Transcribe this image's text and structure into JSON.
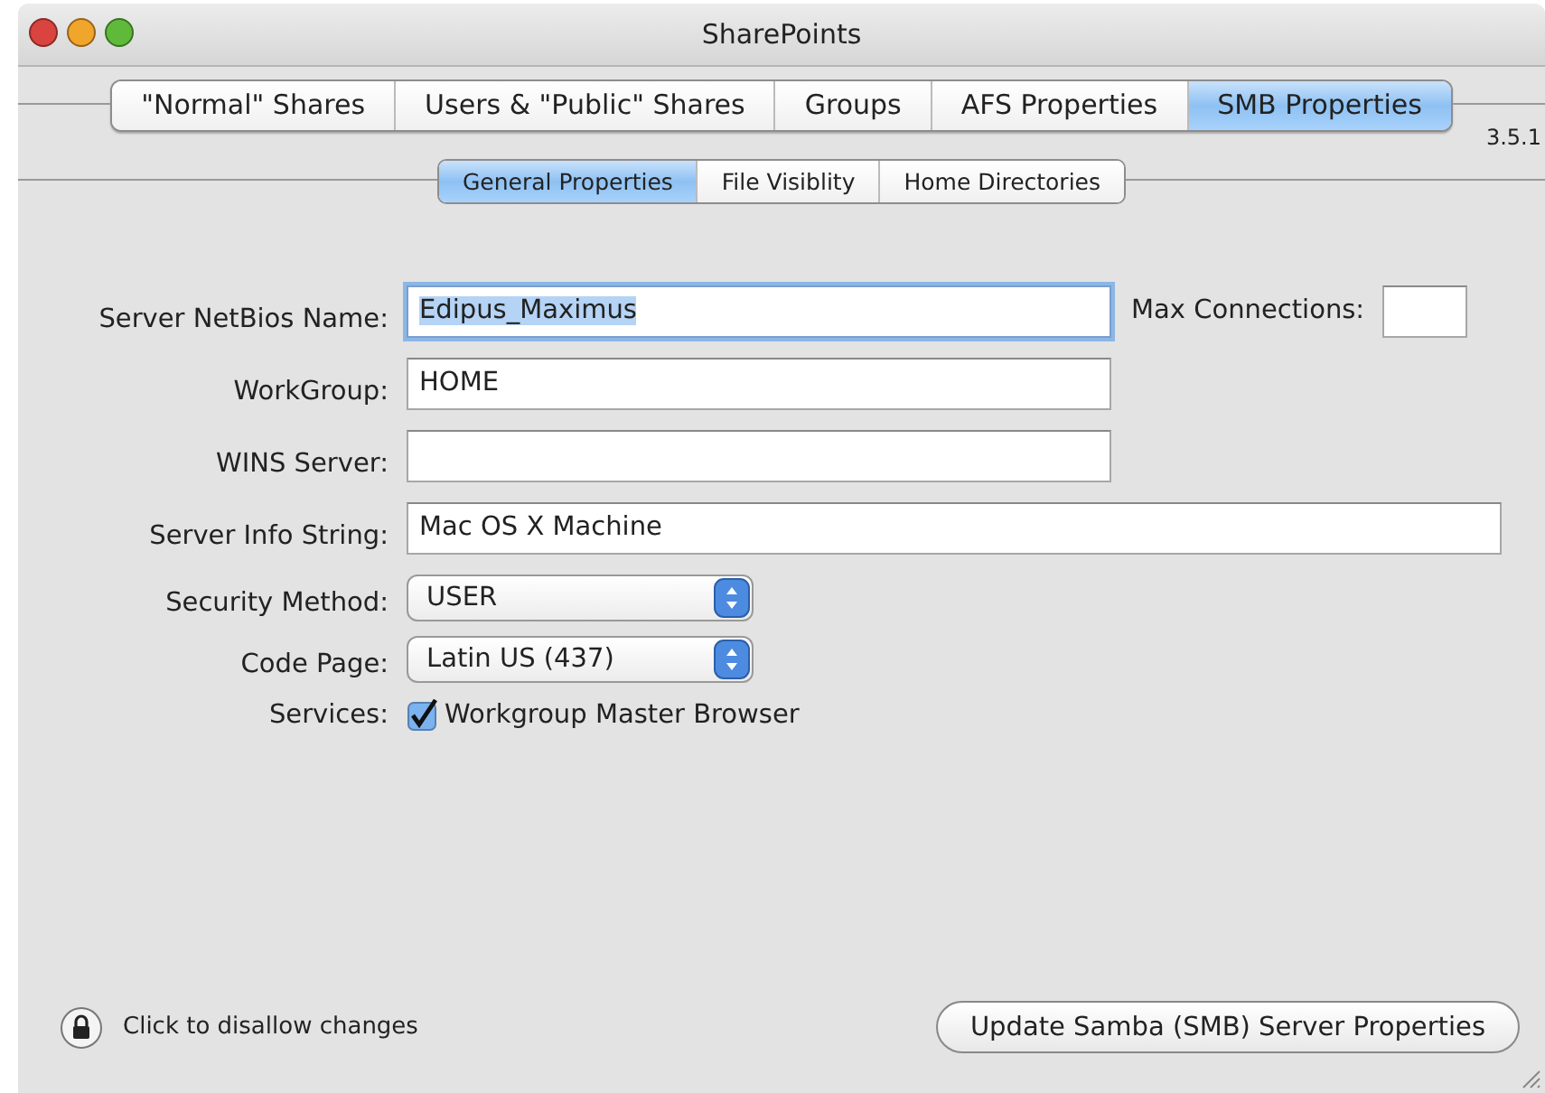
{
  "window": {
    "title": "SharePoints"
  },
  "tabs": [
    {
      "label": "\"Normal\" Shares",
      "selected": false
    },
    {
      "label": "Users & \"Public\" Shares",
      "selected": false
    },
    {
      "label": "Groups",
      "selected": false
    },
    {
      "label": "AFS Properties",
      "selected": false
    },
    {
      "label": "SMB Properties",
      "selected": true
    }
  ],
  "version": "3.5.1",
  "subtabs": [
    {
      "label": "General Properties",
      "selected": true
    },
    {
      "label": "File Visiblity",
      "selected": false
    },
    {
      "label": "Home Directories",
      "selected": false
    }
  ],
  "form": {
    "rows": [
      {
        "kind": "text",
        "label": "Server NetBios Name:",
        "value": "Edipus_Maximus",
        "focused": true,
        "extra": {
          "label": "Max Connections:"
        }
      },
      {
        "kind": "text",
        "label": "WorkGroup:",
        "value": "HOME",
        "focused": false
      },
      {
        "kind": "text",
        "label": "WINS Server:",
        "focused": false
      },
      {
        "kind": "wide",
        "label": "Server Info String:",
        "value": "Mac OS X Machine",
        "focused": false
      },
      {
        "kind": "select",
        "label": "Security Method:",
        "value": "USER"
      },
      {
        "kind": "select",
        "label": "Code Page:",
        "value": "Latin US (437)"
      },
      {
        "kind": "checkbox",
        "label": "Services:",
        "option": "Workgroup Master Browser",
        "checked": true
      }
    ]
  },
  "lock": {
    "text": "Click to disallow changes"
  },
  "button": "Update Samba (SMB) Server Properties"
}
